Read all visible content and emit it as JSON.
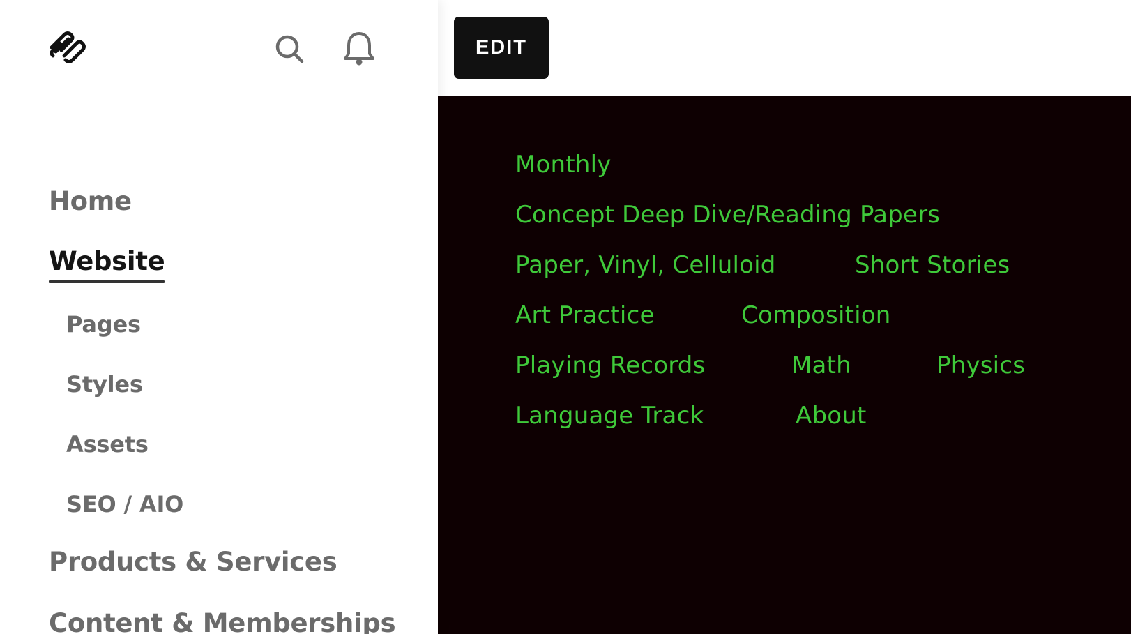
{
  "sidebar": {
    "logo_icon": "squarespace-logo-icon",
    "search_icon": "search-icon",
    "notifications_icon": "bell-icon",
    "nav": {
      "home": "Home",
      "website": "Website",
      "pages": "Pages",
      "styles": "Styles",
      "assets": "Assets",
      "seo": "SEO / AIO",
      "products": "Products & Services",
      "content": "Content & Memberships"
    },
    "active_item": "Website"
  },
  "preview": {
    "edit_label": "EDIT",
    "background_color": "#0e0002",
    "link_color": "#3fc93a",
    "links": {
      "monthly": "Monthly",
      "concept": "Concept Deep Dive/Reading Papers",
      "paper": "Paper, Vinyl, Celluloid",
      "short_stories": "Short Stories",
      "art_practice": "Art Practice",
      "composition": "Composition",
      "playing_records": "Playing Records",
      "math": "Math",
      "physics": "Physics",
      "language_track": "Language Track",
      "about": "About"
    }
  }
}
